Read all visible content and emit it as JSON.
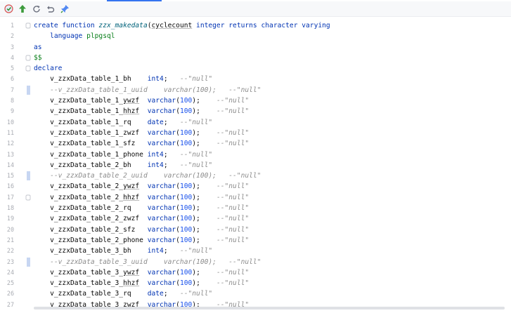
{
  "toolbar": {
    "icons": [
      "execute-icon",
      "commit-icon",
      "refresh-icon",
      "rollback-icon",
      "pin-icon"
    ]
  },
  "colors": {
    "keyword": "#0033b3",
    "function": "#00627a",
    "string": "#067d17",
    "number": "#1750eb",
    "comment": "#8c8c8c",
    "line_number": "#a9acb3",
    "change_marker": "#c7d6f2"
  },
  "code": {
    "lines": [
      {
        "n": "1",
        "fold": "open",
        "marker": false,
        "tokens": [
          [
            "kw",
            "create function "
          ],
          [
            "fn",
            "zzx_makedata"
          ],
          [
            "",
            "("
          ],
          [
            "ul",
            "cyclecount"
          ],
          [
            "",
            ""
          ],
          [
            "kw",
            " integer"
          ],
          [
            "",
            " "
          ],
          [
            "kw",
            "returns character varying"
          ]
        ]
      },
      {
        "n": "2",
        "fold": "",
        "marker": false,
        "tokens": [
          [
            "",
            "    "
          ],
          [
            "kw",
            "language "
          ],
          [
            "str",
            "plpgsql"
          ]
        ]
      },
      {
        "n": "3",
        "fold": "",
        "marker": false,
        "tokens": [
          [
            "kw",
            "as"
          ]
        ]
      },
      {
        "n": "4",
        "fold": "open",
        "marker": false,
        "tokens": [
          [
            "str",
            "$$"
          ]
        ]
      },
      {
        "n": "5",
        "fold": "open",
        "marker": false,
        "tokens": [
          [
            "kw",
            "declare"
          ]
        ]
      },
      {
        "n": "6",
        "fold": "",
        "marker": false,
        "tokens": [
          [
            "",
            "    v_zzxData_table_1_bh    "
          ],
          [
            "kw",
            "int4"
          ],
          [
            "",
            ";   "
          ],
          [
            "cm",
            "--\"null\""
          ]
        ]
      },
      {
        "n": "7",
        "fold": "",
        "marker": true,
        "tokens": [
          [
            "cm",
            "    --v_zzxData_table_1_uuid    varchar(100);   --\"null\""
          ]
        ]
      },
      {
        "n": "8",
        "fold": "",
        "marker": false,
        "tokens": [
          [
            "",
            "    v_zzxData_table_1_"
          ],
          [
            "ul",
            "ywzf"
          ],
          [
            "",
            "  "
          ],
          [
            "kw",
            "varchar"
          ],
          [
            "",
            "("
          ],
          [
            "num",
            "100"
          ],
          [
            "",
            ");    "
          ],
          [
            "cm",
            "--\"null\""
          ]
        ]
      },
      {
        "n": "9",
        "fold": "",
        "marker": false,
        "tokens": [
          [
            "",
            "    v_zzxData_table_1_"
          ],
          [
            "ul",
            "hhzf"
          ],
          [
            "",
            "  "
          ],
          [
            "kw",
            "varchar"
          ],
          [
            "",
            "("
          ],
          [
            "num",
            "100"
          ],
          [
            "",
            ");    "
          ],
          [
            "cm",
            "--\"null\""
          ]
        ]
      },
      {
        "n": "10",
        "fold": "",
        "marker": false,
        "tokens": [
          [
            "",
            "    v_zzxData_table_1_rq    "
          ],
          [
            "kw",
            "date"
          ],
          [
            "",
            ";   "
          ],
          [
            "cm",
            "--\"null\""
          ]
        ]
      },
      {
        "n": "11",
        "fold": "",
        "marker": false,
        "tokens": [
          [
            "",
            "    v_zzxData_table_1_zwzf  "
          ],
          [
            "kw",
            "varchar"
          ],
          [
            "",
            "("
          ],
          [
            "num",
            "100"
          ],
          [
            "",
            ");    "
          ],
          [
            "cm",
            "--\"null\""
          ]
        ]
      },
      {
        "n": "12",
        "fold": "",
        "marker": false,
        "tokens": [
          [
            "",
            "    v_zzxData_table_1_sfz   "
          ],
          [
            "kw",
            "varchar"
          ],
          [
            "",
            "("
          ],
          [
            "num",
            "100"
          ],
          [
            "",
            ");    "
          ],
          [
            "cm",
            "--\"null\""
          ]
        ]
      },
      {
        "n": "13",
        "fold": "",
        "marker": false,
        "tokens": [
          [
            "",
            "    v_zzxData_table_1_phone "
          ],
          [
            "kw",
            "int4"
          ],
          [
            "",
            ";   "
          ],
          [
            "cm",
            "--\"null\""
          ]
        ]
      },
      {
        "n": "14",
        "fold": "",
        "marker": false,
        "tokens": [
          [
            "",
            "    v_zzxData_table_2_bh    "
          ],
          [
            "kw",
            "int4"
          ],
          [
            "",
            ";   "
          ],
          [
            "cm",
            "--\"null\""
          ]
        ]
      },
      {
        "n": "15",
        "fold": "",
        "marker": true,
        "tokens": [
          [
            "cm",
            "    --v_zzxData_table_2_uuid    varchar(100);   --\"null\""
          ]
        ]
      },
      {
        "n": "16",
        "fold": "",
        "marker": false,
        "tokens": [
          [
            "",
            "    v_zzxData_table_2_"
          ],
          [
            "ul",
            "ywzf"
          ],
          [
            "",
            "  "
          ],
          [
            "kw",
            "varchar"
          ],
          [
            "",
            "("
          ],
          [
            "num",
            "100"
          ],
          [
            "",
            ");    "
          ],
          [
            "cm",
            "--\"null\""
          ]
        ]
      },
      {
        "n": "17",
        "fold": "open",
        "marker": false,
        "tokens": [
          [
            "",
            "    v_zzxData_table_2_"
          ],
          [
            "ul",
            "hhzf"
          ],
          [
            "",
            "  "
          ],
          [
            "kw",
            "varchar"
          ],
          [
            "",
            "("
          ],
          [
            "num",
            "100"
          ],
          [
            "",
            ");    "
          ],
          [
            "cm",
            "--\"null\""
          ]
        ]
      },
      {
        "n": "18",
        "fold": "",
        "marker": false,
        "tokens": [
          [
            "",
            "    v_zzxData_table_2_rq    "
          ],
          [
            "kw",
            "varchar"
          ],
          [
            "",
            "("
          ],
          [
            "num",
            "100"
          ],
          [
            "",
            ");    "
          ],
          [
            "cm",
            "--\"null\""
          ]
        ]
      },
      {
        "n": "19",
        "fold": "",
        "marker": false,
        "tokens": [
          [
            "",
            "    v_zzxData_table_2_zwzf  "
          ],
          [
            "kw",
            "varchar"
          ],
          [
            "",
            "("
          ],
          [
            "num",
            "100"
          ],
          [
            "",
            ");    "
          ],
          [
            "cm",
            "--\"null\""
          ]
        ]
      },
      {
        "n": "20",
        "fold": "",
        "marker": false,
        "tokens": [
          [
            "",
            "    v_zzxData_table_2_sfz   "
          ],
          [
            "kw",
            "varchar"
          ],
          [
            "",
            "("
          ],
          [
            "num",
            "100"
          ],
          [
            "",
            ");    "
          ],
          [
            "cm",
            "--\"null\""
          ]
        ]
      },
      {
        "n": "21",
        "fold": "",
        "marker": false,
        "tokens": [
          [
            "",
            "    v_zzxData_table_2_phone "
          ],
          [
            "kw",
            "varchar"
          ],
          [
            "",
            "("
          ],
          [
            "num",
            "100"
          ],
          [
            "",
            ");    "
          ],
          [
            "cm",
            "--\"null\""
          ]
        ]
      },
      {
        "n": "22",
        "fold": "",
        "marker": false,
        "tokens": [
          [
            "",
            "    v_zzxData_table_3_bh    "
          ],
          [
            "kw",
            "int4"
          ],
          [
            "",
            ";   "
          ],
          [
            "cm",
            "--\"null\""
          ]
        ]
      },
      {
        "n": "23",
        "fold": "",
        "marker": true,
        "tokens": [
          [
            "cm",
            "    --v_zzxData_table_3_uuid    varchar(100);   --\"null\""
          ]
        ]
      },
      {
        "n": "24",
        "fold": "",
        "marker": false,
        "tokens": [
          [
            "",
            "    v_zzxData_table_3_"
          ],
          [
            "ul",
            "ywzf"
          ],
          [
            "",
            "  "
          ],
          [
            "kw",
            "varchar"
          ],
          [
            "",
            "("
          ],
          [
            "num",
            "100"
          ],
          [
            "",
            ");    "
          ],
          [
            "cm",
            "--\"null\""
          ]
        ]
      },
      {
        "n": "25",
        "fold": "",
        "marker": false,
        "tokens": [
          [
            "",
            "    v_zzxData_table_3_"
          ],
          [
            "ul",
            "hhzf"
          ],
          [
            "",
            "  "
          ],
          [
            "kw",
            "varchar"
          ],
          [
            "",
            "("
          ],
          [
            "num",
            "100"
          ],
          [
            "",
            ");    "
          ],
          [
            "cm",
            "--\"null\""
          ]
        ]
      },
      {
        "n": "26",
        "fold": "",
        "marker": false,
        "tokens": [
          [
            "",
            "    v_zzxData_table_3_rq    "
          ],
          [
            "kw",
            "date"
          ],
          [
            "",
            ";   "
          ],
          [
            "cm",
            "--\"null\""
          ]
        ]
      },
      {
        "n": "27",
        "fold": "",
        "marker": false,
        "tokens": [
          [
            "",
            "    v_zzxData_table_3_zwzf  "
          ],
          [
            "kw",
            "varchar"
          ],
          [
            "",
            "("
          ],
          [
            "num",
            "100"
          ],
          [
            "",
            ");    "
          ],
          [
            "cm",
            "--\"null\""
          ]
        ]
      }
    ]
  }
}
